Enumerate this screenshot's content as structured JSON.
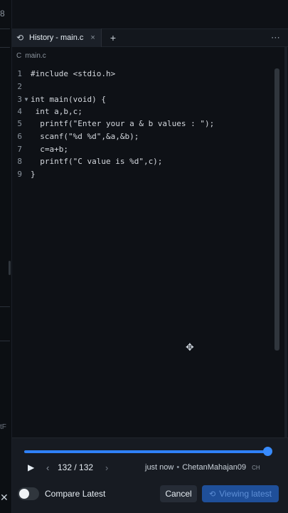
{
  "tabbar": {
    "tab_label": "History - main.c",
    "close": "×",
    "add": "+",
    "more": "⋯"
  },
  "breadcrumb": {
    "file": "main.c"
  },
  "code_lines": [
    {
      "num": "1",
      "fold": "",
      "text": "#include <stdio.h>"
    },
    {
      "num": "2",
      "fold": "",
      "text": ""
    },
    {
      "num": "3",
      "fold": "▼",
      "text": "int main(void) {"
    },
    {
      "num": "4",
      "fold": "",
      "text": " int a,b,c;"
    },
    {
      "num": "5",
      "fold": "",
      "text": "  printf(\"Enter your a & b values : \");"
    },
    {
      "num": "6",
      "fold": "",
      "text": "  scanf(\"%d %d\",&a,&b);"
    },
    {
      "num": "7",
      "fold": "",
      "text": "  c=a+b;"
    },
    {
      "num": "8",
      "fold": "",
      "text": "  printf(\"C value is %d\",c);"
    },
    {
      "num": "9",
      "fold": "",
      "text": "}"
    }
  ],
  "history": {
    "progress": 1.0,
    "counter": "132 / 132",
    "time": "just now",
    "author": "ChetanMahajan09",
    "initials": "CH",
    "compare_label": "Compare Latest",
    "cancel_label": "Cancel",
    "viewing_label": "Viewing latest"
  },
  "left_strip": {
    "tf": "tF"
  },
  "colors": {
    "accent": "#2f81f7",
    "background": "#0e1116",
    "footer": "#171b22"
  },
  "icons": [
    "history-icon",
    "close-icon",
    "plus-icon",
    "more-icon",
    "file-icon",
    "play-icon",
    "chevron-left-icon",
    "chevron-right-icon",
    "restore-icon",
    "move-cursor-icon"
  ]
}
